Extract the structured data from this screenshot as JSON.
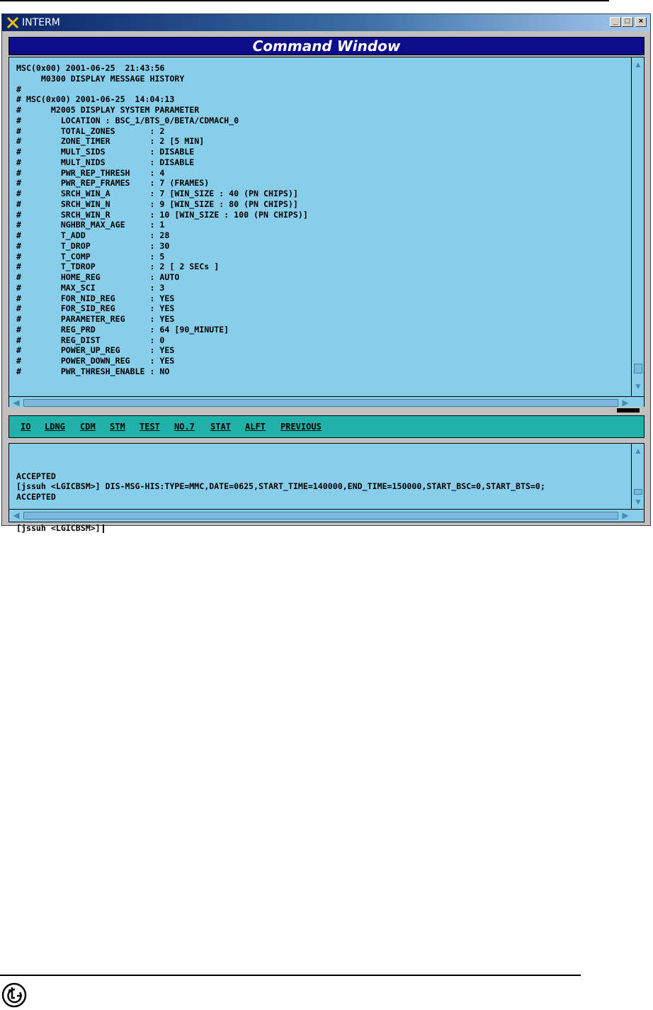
{
  "window": {
    "title": "INTERM",
    "header": "Command Window",
    "buttons": {
      "minimize": "_",
      "maximize": "□",
      "close": "×"
    }
  },
  "output": {
    "lines": [
      "MSC(0x00) 2001-06-25  21:43:56",
      "     M0300 DISPLAY MESSAGE HISTORY",
      "#",
      "# MSC(0x00) 2001-06-25  14:04:13",
      "#      M2005 DISPLAY SYSTEM PARAMETER",
      "#        LOCATION : BSC_1/BTS_0/BETA/CDMACH_0",
      "#        TOTAL_ZONES       : 2",
      "#        ZONE_TIMER        : 2 [5 MIN]",
      "#        MULT_SIDS         : DISABLE",
      "#        MULT_NIDS         : DISABLE",
      "#        PWR_REP_THRESH    : 4",
      "#        PWR_REP_FRAMES    : 7 (FRAMES)",
      "#        SRCH_WIN_A        : 7 [WIN_SIZE : 40 (PN CHIPS)]",
      "#        SRCH_WIN_N        : 9 [WIN_SIZE : 80 (PN CHIPS)]",
      "#        SRCH_WIN_R        : 10 [WIN_SIZE : 100 (PN CHIPS)]",
      "#        NGHBR_MAX_AGE     : 1",
      "#        T_ADD             : 28",
      "#        T_DROP            : 30",
      "#        T_COMP            : 5",
      "#        T_TDROP           : 2 [ 2 SECs ]",
      "#        HOME_REG          : AUTO",
      "#        MAX_SCI           : 3",
      "#        FOR_NID_REG       : YES",
      "#        FOR_SID_REG       : YES",
      "#        PARAMETER_REG     : YES",
      "#        REG_PRD           : 64 [90_MINUTE]",
      "#        REG_DIST          : 0",
      "#        POWER_UP_REG      : YES",
      "#        POWER_DOWN_REG    : YES",
      "#        PWR_THRESH_ENABLE : NO"
    ]
  },
  "menu": {
    "items": [
      "IO",
      "LDNG",
      "CDM",
      "STM",
      "TEST",
      "NO.7",
      "STAT",
      "ALFT",
      "PREVIOUS"
    ]
  },
  "input": {
    "lines": [
      "ACCEPTED",
      "[jssuh <LGICBSM>] DIS-MSG-HIS:TYPE=MMC,DATE=0625,START_TIME=140000,END_TIME=150000,START_BSC=0,START_BTS=0;",
      "ACCEPTED"
    ],
    "prompt": "[jssuh <LGICBSM>]"
  },
  "scroll_arrows": {
    "up": "▲",
    "down": "▼",
    "left": "◀",
    "right": "▶"
  }
}
